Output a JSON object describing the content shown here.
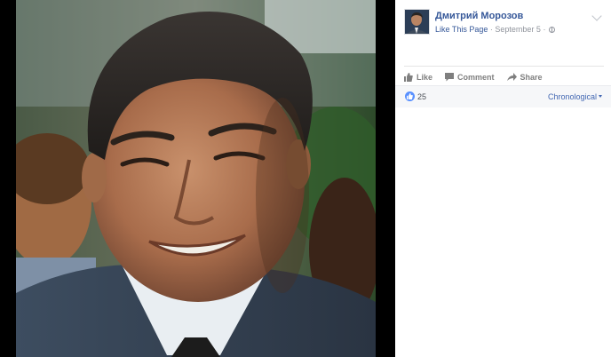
{
  "post": {
    "page_name": "Дмитрий Морозов",
    "like_page": "Like This Page",
    "separator": "·",
    "date": "September 5",
    "separator2": "·"
  },
  "actions": {
    "like": "Like",
    "comment": "Comment",
    "share": "Share"
  },
  "reactions": {
    "count": "25",
    "sort_label": "Chronological"
  },
  "icons": {
    "privacy": "globe-icon",
    "options": "chevron-down-icon",
    "like": "thumbs-up-icon",
    "comment": "comment-icon",
    "share": "share-icon"
  },
  "colors": {
    "link": "#365899",
    "meta": "#90949c",
    "like_badge": "#5890ff"
  }
}
